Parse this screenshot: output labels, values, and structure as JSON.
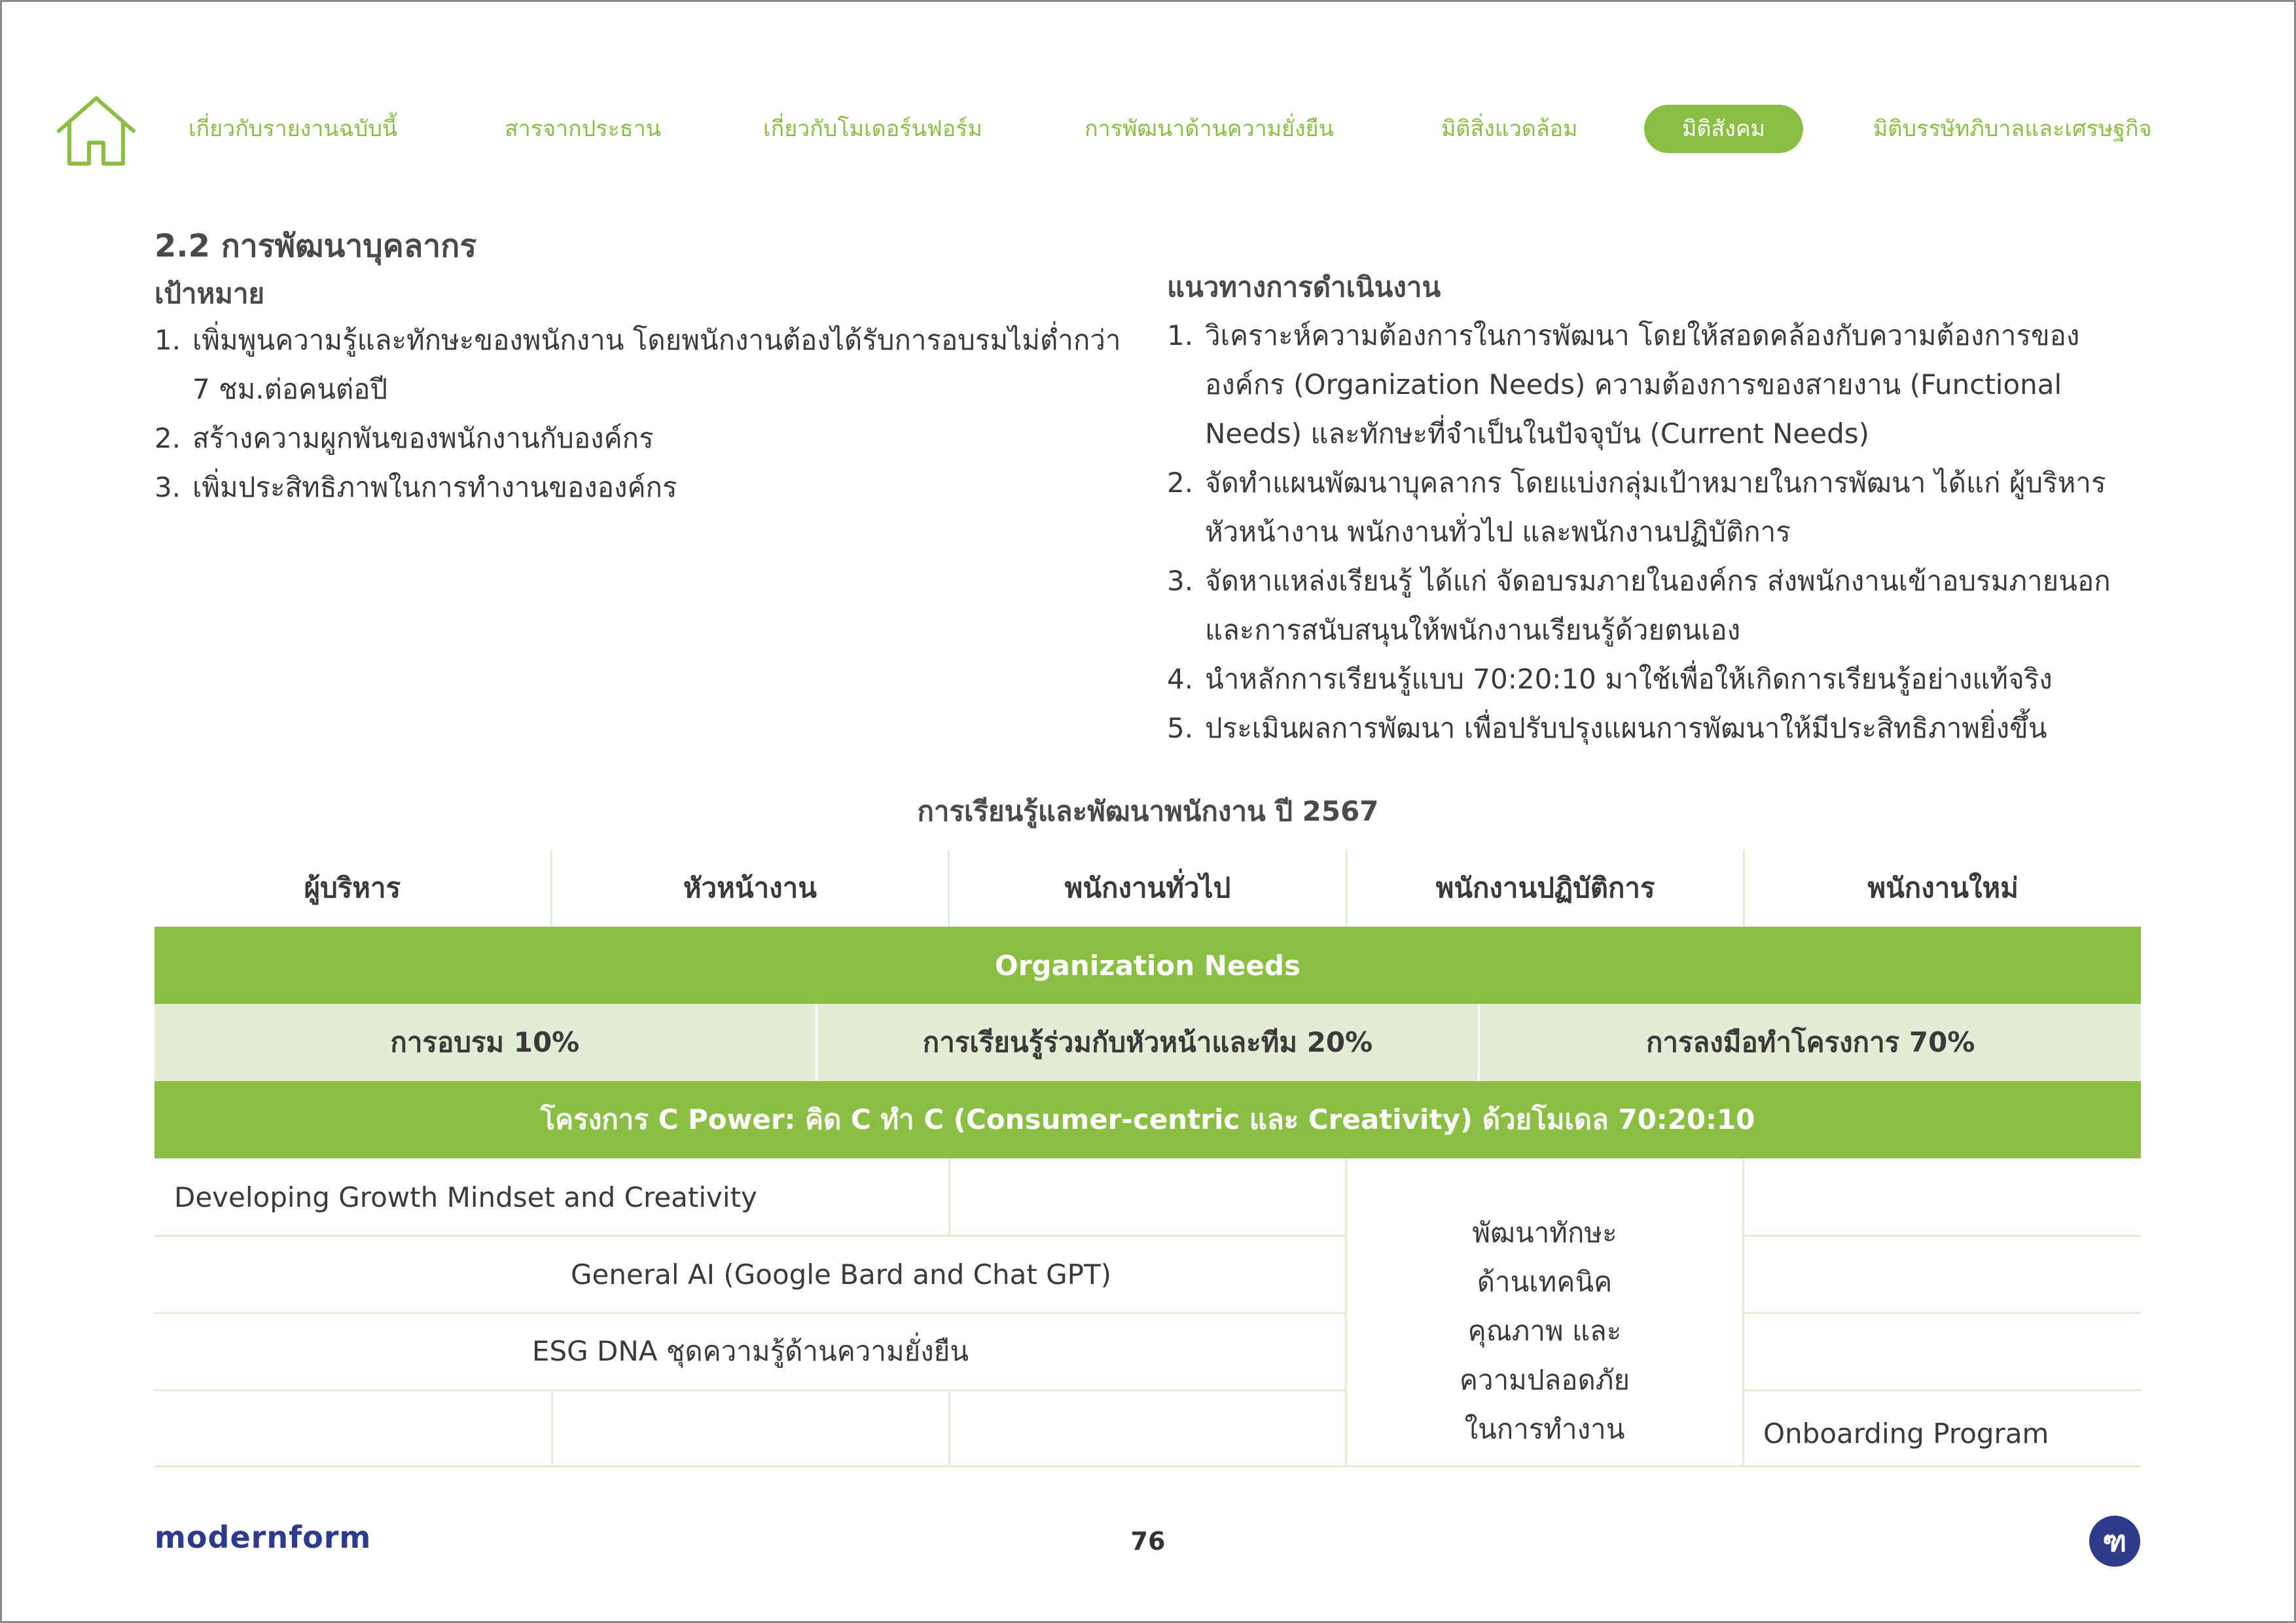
{
  "nav": {
    "items": [
      "เกี่ยวกับรายงานฉบับนี้",
      "สารจากประธาน",
      "เกี่ยวกับโมเดอร์นฟอร์ม",
      "การพัฒนาด้านความยั่งยืน",
      "มิติสิ่งแวดล้อม",
      "มิติสังคม",
      "มิติบรรษัทภิบาลและเศรษฐกิจ"
    ],
    "active_index": 5,
    "accent_color": "#8bbf44",
    "home_icon": "home-icon"
  },
  "section": {
    "title": "2.2 การพัฒนาบุคลากร",
    "goals_heading": "เป้าหมาย",
    "goals": [
      {
        "num": "1.",
        "text": "เพิ่มพูนความรู้และทักษะของพนักงาน โดยพนักงานต้องได้รับการอบรมไม่ต่ำกว่า 7 ชม.ต่อคนต่อปี"
      },
      {
        "num": "2.",
        "text": "สร้างความผูกพันของพนักงานกับองค์กร"
      },
      {
        "num": "3.",
        "text": "เพิ่มประสิทธิภาพในการทำงานขององค์กร"
      }
    ],
    "approach_heading": "แนวทางการดำเนินงาน",
    "approach": [
      {
        "num": "1.",
        "text": "วิเคราะห์ความต้องการในการพัฒนา โดยให้สอดคล้องกับความต้องการขององค์กร (Organization Needs) ความต้องการของสายงาน (Functional Needs) และทักษะที่จำเป็นในปัจจุบัน (Current Needs)"
      },
      {
        "num": "2.",
        "text": "จัดทำแผนพัฒนาบุคลากร โดยแบ่งกลุ่มเป้าหมายในการพัฒนา ได้แก่ ผู้บริหาร หัวหน้างาน พนักงานทั่วไป และพนักงานปฏิบัติการ"
      },
      {
        "num": "3.",
        "text": "จัดหาแหล่งเรียนรู้ ได้แก่ จัดอบรมภายในองค์กร ส่งพนักงานเข้าอบรมภายนอก และการสนับสนุนให้พนักงานเรียนรู้ด้วยตนเอง"
      },
      {
        "num": "4.",
        "text": "นำหลักการเรียนรู้แบบ 70:20:10 มาใช้เพื่อให้เกิดการเรียนรู้อย่างแท้จริง"
      },
      {
        "num": "5.",
        "text": "ประเมินผลการพัฒนา เพื่อปรับปรุงแผนการพัฒนาให้มีประสิทธิภาพยิ่งขึ้น"
      }
    ]
  },
  "table": {
    "title": "การเรียนรู้และพัฒนาพนักงาน ปี 2567",
    "columns": [
      "ผู้บริหาร",
      "หัวหน้างาน",
      "พนักงานทั่วไป",
      "พนักงานปฏิบัติการ",
      "พนักงานใหม่"
    ],
    "band1": "Organization Needs",
    "mix": [
      "การอบรม 10%",
      "การเรียนรู้ร่วมกับหัวหน้าและทีม 20%",
      "การลงมือทำโครงการ 70%"
    ],
    "band2": "โครงการ C Power: คิด C ทำ C (Consumer-centric และ Creativity)  ด้วยโมเดล 70:20:10",
    "programs": {
      "growth": "Developing Growth Mindset and Creativity",
      "ai": "General AI (Google Bard and Chat GPT)",
      "esg": "ESG DNA ชุดความรู้ด้านความยั่งยืน",
      "ops_lines": [
        "พัฒนาทักษะ",
        "ด้านเทคนิค",
        "คุณภาพ และ",
        "ความปลอดภัย",
        "ในการทำงาน"
      ],
      "onboarding": "Onboarding Program"
    }
  },
  "footer": {
    "brand": "modernform",
    "page": "76",
    "logo_glyph": "ฑ",
    "brand_color": "#2e3a8c"
  }
}
